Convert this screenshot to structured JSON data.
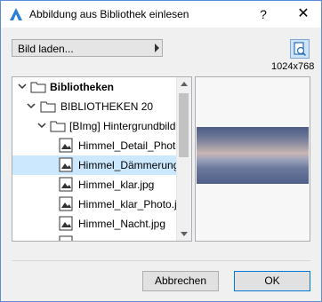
{
  "window": {
    "title": "Abbildung aus Bibliothek einlesen",
    "help_label": "?",
    "close_label": "✕"
  },
  "toolbar": {
    "load_button_label": "Bild laden...",
    "image_dimensions": "1024x768"
  },
  "tree": {
    "root": "Bibliotheken",
    "library": "BIBLIOTHEKEN 20",
    "folder": "[BImg] Hintergrundbilder",
    "items": [
      "Himmel_Detail_Photo.jpg",
      "Himmel_Dämmerung_Photo.jpg",
      "Himmel_klar.jpg",
      "Himmel_klar_Photo.jpg",
      "Himmel_Nacht.jpg"
    ],
    "selected_index": 1
  },
  "buttons": {
    "cancel_label": "Abbrechen",
    "ok_label": "OK"
  },
  "colors": {
    "accent": "#0078d7",
    "selection": "#cce8ff"
  }
}
